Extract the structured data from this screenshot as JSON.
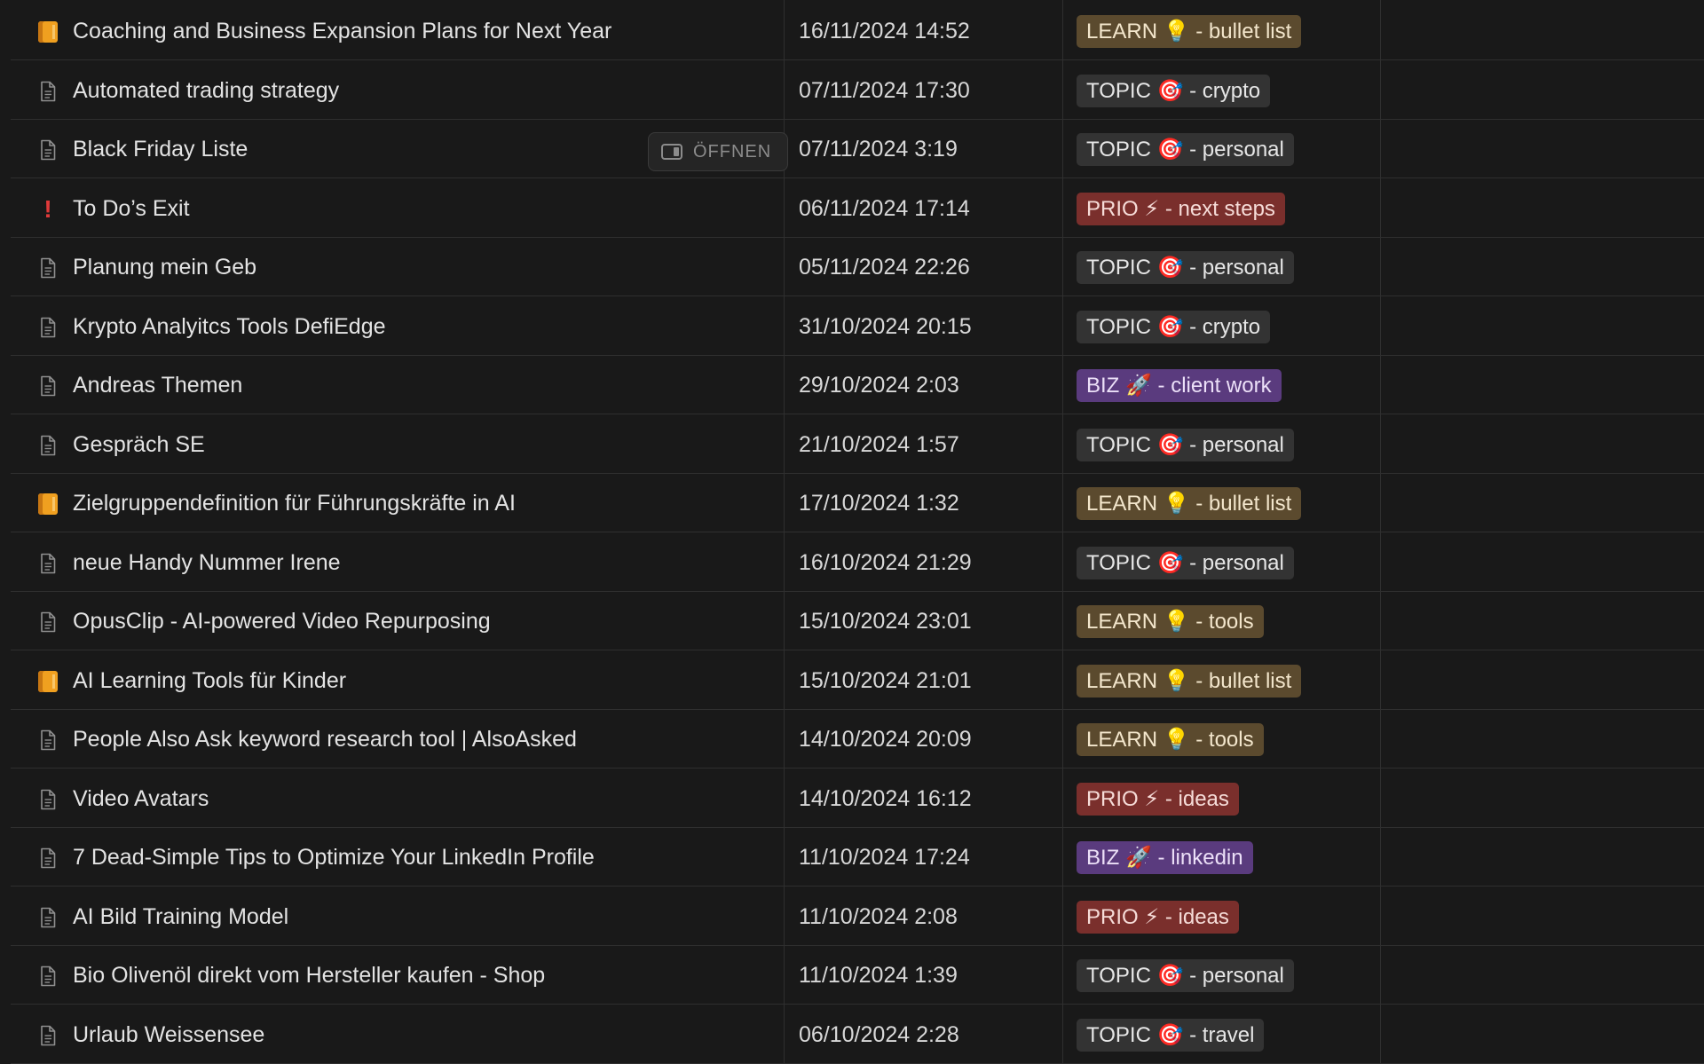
{
  "table": {
    "rows": [
      {
        "icon": "book-icon",
        "title": "Coaching and Business Expansion Plans for Next Year",
        "date": "16/11/2024 14:52",
        "tag": "LEARN 💡 - bullet list",
        "tag_kind": "learn"
      },
      {
        "icon": "page-icon",
        "title": "Automated trading strategy",
        "date": "07/11/2024 17:30",
        "tag": "TOPIC 🎯 - crypto",
        "tag_kind": "topic"
      },
      {
        "icon": "page-icon",
        "title": "Black Friday Liste",
        "date": "07/11/2024 3:19",
        "tag": "TOPIC 🎯 - personal",
        "tag_kind": "topic",
        "open_label": "ÖFFNEN"
      },
      {
        "icon": "exclamation-icon",
        "title": "To Do’s Exit",
        "date": "06/11/2024 17:14",
        "tag": "PRIO ⚡ - next steps",
        "tag_kind": "prio"
      },
      {
        "icon": "page-icon",
        "title": "Planung mein Geb",
        "date": "05/11/2024 22:26",
        "tag": "TOPIC 🎯 - personal",
        "tag_kind": "topic"
      },
      {
        "icon": "page-icon",
        "title": "Krypto Analyitcs Tools DefiEdge",
        "date": "31/10/2024 20:15",
        "tag": "TOPIC 🎯 - crypto",
        "tag_kind": "topic"
      },
      {
        "icon": "page-icon",
        "title": "Andreas Themen",
        "date": "29/10/2024 2:03",
        "tag": "BIZ 🚀 - client work",
        "tag_kind": "biz"
      },
      {
        "icon": "page-icon",
        "title": "Gespräch SE",
        "date": "21/10/2024 1:57",
        "tag": "TOPIC 🎯 - personal",
        "tag_kind": "topic"
      },
      {
        "icon": "book-icon",
        "title": "Zielgruppendefinition für Führungskräfte in AI",
        "date": "17/10/2024 1:32",
        "tag": "LEARN 💡 - bullet list",
        "tag_kind": "learn"
      },
      {
        "icon": "page-icon",
        "title": "neue Handy Nummer Irene",
        "date": "16/10/2024 21:29",
        "tag": "TOPIC 🎯 - personal",
        "tag_kind": "topic"
      },
      {
        "icon": "page-icon",
        "title": "OpusClip - AI-powered Video Repurposing",
        "date": "15/10/2024 23:01",
        "tag": "LEARN 💡 - tools",
        "tag_kind": "learn"
      },
      {
        "icon": "book-icon",
        "title": "AI Learning Tools für Kinder",
        "date": "15/10/2024 21:01",
        "tag": "LEARN 💡 - bullet list",
        "tag_kind": "learn"
      },
      {
        "icon": "page-icon",
        "title": "People Also Ask keyword research tool | AlsoAsked",
        "date": "14/10/2024 20:09",
        "tag": "LEARN 💡 - tools",
        "tag_kind": "learn"
      },
      {
        "icon": "page-icon",
        "title": "Video Avatars",
        "date": "14/10/2024 16:12",
        "tag": "PRIO ⚡ - ideas",
        "tag_kind": "prio"
      },
      {
        "icon": "page-icon",
        "title": "7 Dead-Simple Tips to Optimize Your LinkedIn Profile",
        "date": "11/10/2024 17:24",
        "tag": "BIZ 🚀 - linkedin",
        "tag_kind": "biz"
      },
      {
        "icon": "page-icon",
        "title": "AI Bild Training Model",
        "date": "11/10/2024 2:08",
        "tag": "PRIO ⚡ - ideas",
        "tag_kind": "prio"
      },
      {
        "icon": "page-icon",
        "title": "Bio Olivenöl direkt vom Hersteller kaufen - Shop",
        "date": "11/10/2024 1:39",
        "tag": "TOPIC 🎯 - personal",
        "tag_kind": "topic"
      },
      {
        "icon": "page-icon",
        "title": "Urlaub Weissensee",
        "date": "06/10/2024 2:28",
        "tag": "TOPIC 🎯 - travel",
        "tag_kind": "topic"
      }
    ]
  },
  "colors": {
    "background": "#191919",
    "learn_tag": "#5b4a2e",
    "topic_tag": "#333333",
    "prio_tag": "#7a2f2c",
    "biz_tag": "#5a3b7e"
  }
}
